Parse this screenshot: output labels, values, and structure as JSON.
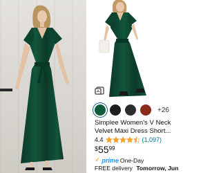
{
  "product": {
    "title_line1": "Simplee Women's V Neck",
    "title_line2": "Velvet Maxi Dress Short...",
    "rating": "4.4",
    "stars_filled": 4.5,
    "review_count": "(1,097)",
    "price_symbol": "$",
    "price_whole": "55",
    "price_fraction": "99",
    "prime_label": "prime",
    "prime_suffix": "One-Day",
    "delivery_prefix": "FREE delivery",
    "delivery_date": "Tomorrow, Jun"
  },
  "colors": {
    "swatches": [
      "#0e5a3c",
      "#1d1d1d",
      "#2c2c2c",
      "#8a2a1a"
    ],
    "more_label": "+26",
    "dress": "#0f4a33",
    "accent_link": "#007185",
    "prime_blue": "#1a98ff",
    "star": "#ffa41c"
  },
  "icons": {
    "view_360": "view-360-icon",
    "star": "star-icon",
    "prime_check": "prime-check-icon"
  },
  "prime_check_glyph": "✓"
}
